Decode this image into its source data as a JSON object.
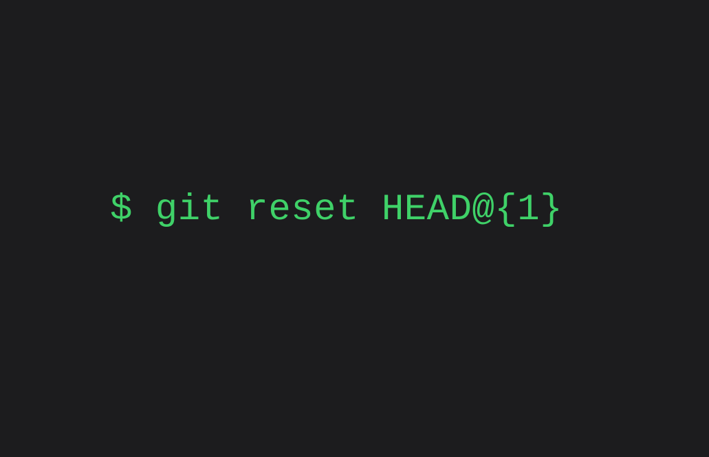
{
  "terminal": {
    "command": "$ git reset HEAD@{1}"
  }
}
